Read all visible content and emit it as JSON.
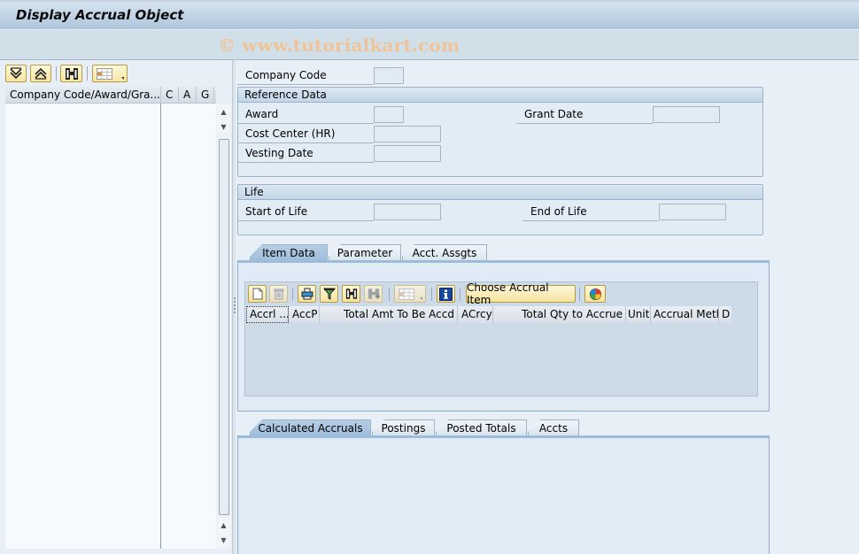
{
  "window": {
    "title": "Display Accrual Object",
    "watermark": "© www.tutorialkart.com"
  },
  "left_panel": {
    "toolbar": [
      {
        "name": "expand-all",
        "icon": "expand-all-icon"
      },
      {
        "name": "collapse-all",
        "icon": "collapse-all-icon"
      },
      {
        "name": "find",
        "icon": "binoculars-icon"
      },
      {
        "name": "layout",
        "icon": "layout-grid-icon"
      }
    ],
    "tree_columns": [
      "Company Code/Award/Gra...",
      "C",
      "A",
      "G"
    ],
    "rows": []
  },
  "header_fields": {
    "company_code": {
      "label": "Company Code",
      "value": ""
    }
  },
  "reference_data": {
    "title": "Reference Data",
    "award": {
      "label": "Award",
      "value": ""
    },
    "grant_date": {
      "label": "Grant Date",
      "value": ""
    },
    "cost_center": {
      "label": "Cost Center (HR)",
      "value": ""
    },
    "vesting_date": {
      "label": "Vesting Date",
      "value": ""
    }
  },
  "life": {
    "title": "Life",
    "start_of_life": {
      "label": "Start of Life",
      "value": ""
    },
    "end_of_life": {
      "label": "End of Life",
      "value": ""
    }
  },
  "item_tabs": {
    "tabs": [
      "Item Data",
      "Parameter",
      "Acct. Assgts"
    ],
    "active": "Item Data",
    "toolbar": {
      "choose_accrual_item": "Choose Accrual Item"
    },
    "columns": [
      "Accrl ...",
      "AccP",
      "Total Amt To Be Accd",
      "ACrcy",
      "Total Qty to Accrue",
      "Unit",
      "Accrual Meth",
      "D"
    ],
    "rows": []
  },
  "result_tabs": {
    "tabs": [
      "Calculated Accruals",
      "Postings",
      "Posted Totals",
      "Accts"
    ],
    "active": "Calculated Accruals"
  },
  "colors": {
    "toolbar_button": "#f6e5a2",
    "active_tab": "#9dbcdb",
    "panel_bg": "#e0ebf5",
    "watermark": "#efc49a"
  }
}
